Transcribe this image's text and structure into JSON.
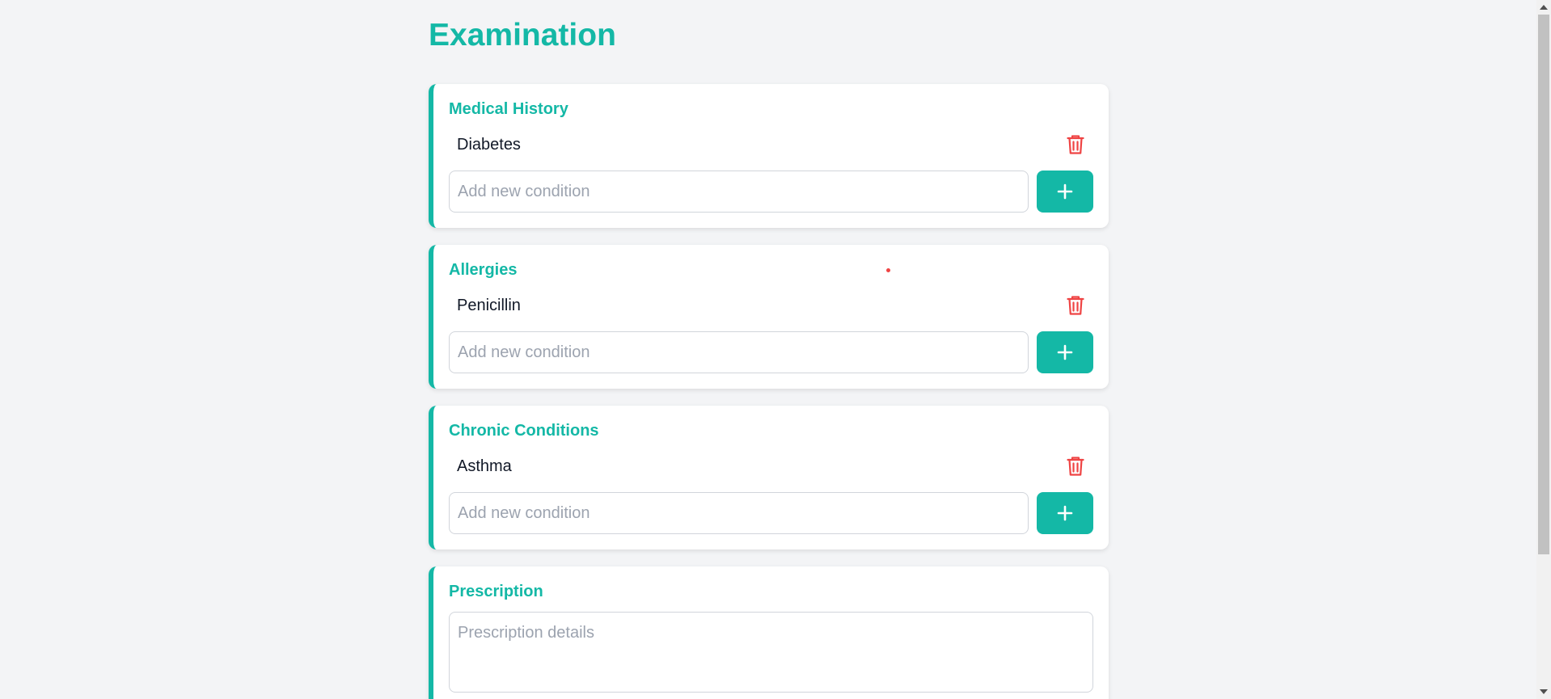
{
  "page": {
    "title": "Examination"
  },
  "sections": [
    {
      "title": "Medical History",
      "items": [
        "Diabetes"
      ],
      "input_placeholder": "Add new condition",
      "add_icon": "plus-icon",
      "delete_icon": "trash-icon"
    },
    {
      "title": "Allergies",
      "items": [
        "Penicillin"
      ],
      "input_placeholder": "Add new condition",
      "add_icon": "plus-icon",
      "delete_icon": "trash-icon"
    },
    {
      "title": "Chronic Conditions",
      "items": [
        "Asthma"
      ],
      "input_placeholder": "Add new condition",
      "add_icon": "plus-icon",
      "delete_icon": "trash-icon"
    }
  ],
  "prescription": {
    "title": "Prescription",
    "placeholder": "Prescription details"
  },
  "colors": {
    "accent": "#14b8a6",
    "danger": "#ef4444",
    "background": "#f3f4f6",
    "card": "#ffffff",
    "placeholder": "#9ca3af"
  }
}
